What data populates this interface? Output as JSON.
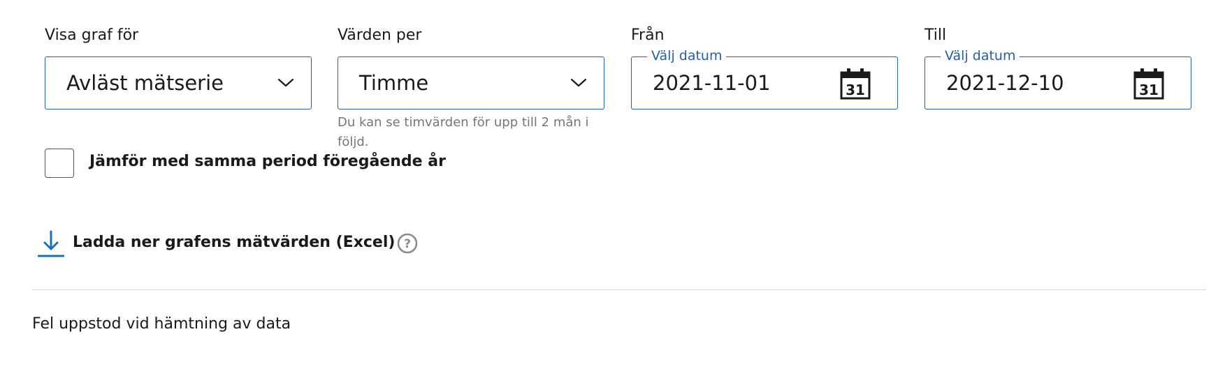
{
  "filters": {
    "graph_for": {
      "label": "Visa graf för",
      "selected": "Avläst mätserie"
    },
    "values_per": {
      "label": "Värden per",
      "selected": "Timme",
      "hint": "Du kan se timvärden för upp till 2 mån i följd."
    },
    "from": {
      "label": "Från",
      "legend": "Välj datum",
      "value": "2021-11-01"
    },
    "to": {
      "label": "Till",
      "legend": "Välj datum",
      "value": "2021-12-10"
    }
  },
  "compare": {
    "label": "Jämför med samma period föregående år",
    "checked": false
  },
  "download": {
    "label": "Ladda ner grafens mätvärden (Excel)"
  },
  "icons": {
    "chevron": "chevron-down-icon",
    "calendar": "calendar-icon",
    "calendar_day": "31",
    "download": "download-icon",
    "help": "help-icon",
    "help_glyph": "?"
  },
  "status": {
    "error": "Fel uppstod vid hämtning av data"
  },
  "colors": {
    "accent": "#2a5d9a",
    "download_icon": "#1f6fb2",
    "hint_text": "#767676",
    "help_icon": "#8a8a8a"
  }
}
